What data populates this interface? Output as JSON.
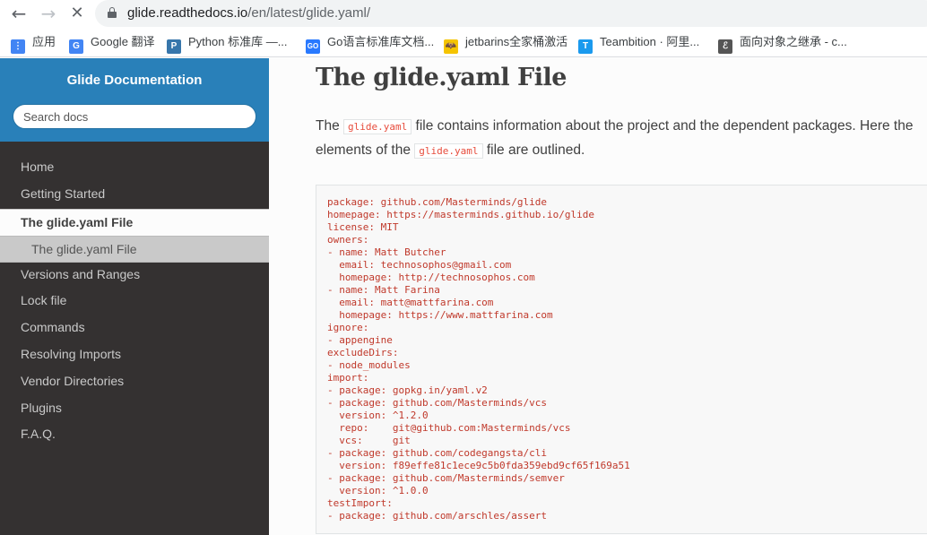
{
  "browser": {
    "url_host": "glide.readthedocs.io",
    "url_path": "/en/latest/glide.yaml/",
    "bookmarks": [
      {
        "label": "应用",
        "icon": "apps-grid-icon",
        "color": "#4285f4"
      },
      {
        "label": "Google 翻译",
        "icon": "google-translate-icon",
        "color": "#4285f4"
      },
      {
        "label": "Python 标准库 —...",
        "icon": "python-icon",
        "color": "#3776ab"
      },
      {
        "label": "Go语言标准库文档...",
        "icon": "go-icon",
        "color": "#2979ff"
      },
      {
        "label": "jetbarins全家桶激活",
        "icon": "bat-icon",
        "color": "#f5c400"
      },
      {
        "label": "Teambition · 阿里...",
        "icon": "teambition-icon",
        "color": "#1b9aee"
      },
      {
        "label": "面向对象之继承 - c...",
        "icon": "ornament-icon",
        "color": "#555555"
      }
    ]
  },
  "sidebar": {
    "project_title": " Glide Documentation",
    "search_placeholder": "Search docs",
    "items": [
      {
        "label": "Home",
        "state": "normal"
      },
      {
        "label": "Getting Started",
        "state": "normal"
      },
      {
        "label": "The glide.yaml File",
        "state": "current"
      },
      {
        "label": "The glide.yaml File",
        "state": "sub"
      },
      {
        "label": "Versions and Ranges",
        "state": "normal"
      },
      {
        "label": "Lock file",
        "state": "normal"
      },
      {
        "label": "Commands",
        "state": "normal"
      },
      {
        "label": "Resolving Imports",
        "state": "normal"
      },
      {
        "label": "Vendor Directories",
        "state": "normal"
      },
      {
        "label": "Plugins",
        "state": "normal"
      },
      {
        "label": "F.A.Q.",
        "state": "normal"
      }
    ]
  },
  "main": {
    "title": "The glide.yaml File",
    "intro": {
      "p1": "The ",
      "lit1": "glide.yaml",
      "p2": " file contains information about the project and the dependent packages. Here the elements of the ",
      "lit2": "glide.yaml",
      "p3": " file are outlined."
    },
    "code_lines": [
      "package: github.com/Masterminds/glide",
      "homepage: https://masterminds.github.io/glide",
      "license: MIT",
      "owners:",
      "- name: Matt Butcher",
      "  email: technosophos@gmail.com",
      "  homepage: http://technosophos.com",
      "- name: Matt Farina",
      "  email: matt@mattfarina.com",
      "  homepage: https://www.mattfarina.com",
      "ignore:",
      "- appengine",
      "excludeDirs:",
      "- node_modules",
      "import:",
      "- package: gopkg.in/yaml.v2",
      "- package: github.com/Masterminds/vcs",
      "  version: ^1.2.0",
      "  repo:    git@github.com:Masterminds/vcs",
      "  vcs:     git",
      "- package: github.com/codegangsta/cli",
      "  version: f89effe81c1ece9c5b0fda359ebd9cf65f169a51",
      "- package: github.com/Masterminds/semver",
      "  version: ^1.0.0",
      "testImport:",
      "- package: github.com/arschles/assert"
    ]
  }
}
